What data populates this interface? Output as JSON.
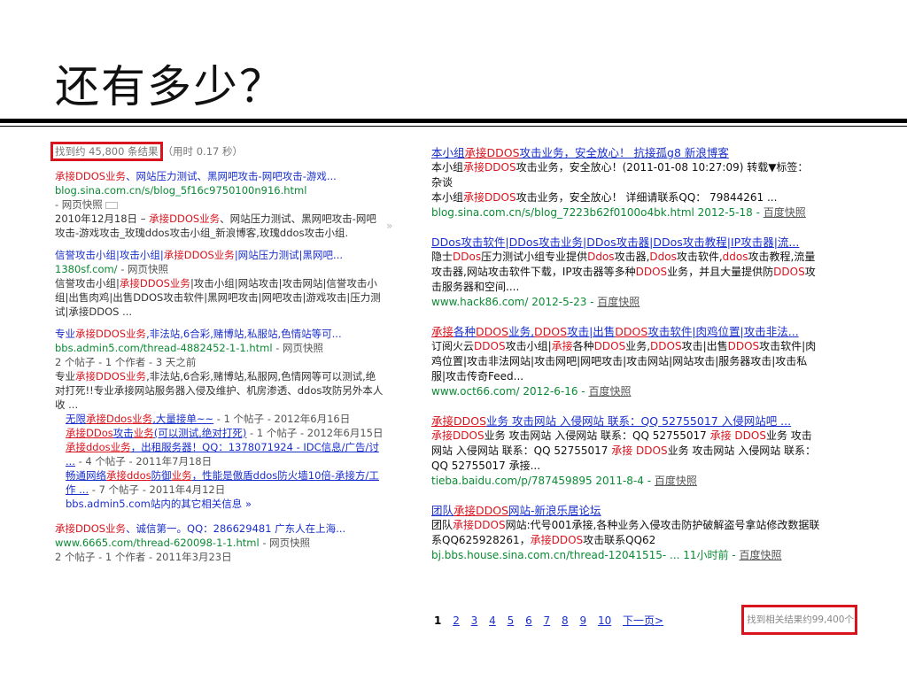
{
  "slide": {
    "title": "还有多少？"
  },
  "google": {
    "stats_count": "找到约 45,800 条结果",
    "stats_time": "（用时 0.17 秒）",
    "arrow": "»",
    "r1": {
      "title_a": "承接DDOS业务",
      "title_b": "、网站压力测试、黑网吧攻击-网吧攻击-游戏...",
      "url": "blog.sina.com.cn/s/blog_5f16c9750100n916.html",
      "cache": "- 网页快照",
      "date": "2010年12月18日 – ",
      "kw": "承接DDOS业务",
      "snippet": "、网站压力测试、黑网吧攻击-网吧攻击-游戏攻击_玫瑰ddos攻击小组_新浪博客,玫瑰ddos攻击小组."
    },
    "r2": {
      "title_a": "信誉攻击小组|攻击小组|",
      "title_kw": "承接DDOS业务",
      "title_b": "|网站压力测试|黑网吧...",
      "url": "1380sf.com/",
      "cache": " - 网页快照",
      "snip_a": "信誉攻击小组|",
      "snip_kw": "承接DDOS业务",
      "snip_b": "|攻击小组|网站攻击|攻击网站|信誉攻击小组|出售肉鸡|出售DDOS攻击软件|黑网吧攻击|网吧攻击|游戏攻击|压力测试|承接DDOS ..."
    },
    "r3": {
      "title_a": "专业",
      "title_kw": "承接DDOS业务",
      "title_b": ",非法站,6合彩,赌博站,私服站,色情站等可...",
      "url": "bbs.admin5.com/thread-4882452-1-1.html",
      "cache": " - 网页快照",
      "meta": "2 个帖子 - 1 个作者 - 3 天之前",
      "snip_a": "专业",
      "snip_kw": "承接DDOS业务",
      "snip_b": ",非法站,6合彩,赌博站,私服网,色情网等可以测试,绝对打死!!专业承接网站服务器入侵及维护、机房渗透、ddos攻防另外本人收 ...",
      "s1_a": "无限",
      "s1_kw": "承接Ddos业务",
      "s1_b": ",大量接单~~",
      "s1_meta": " - 1 个帖子 - 2012年6月16日",
      "s2_kw": "承接DDos",
      "s2_a": "攻击",
      "s2_kw2": "业务",
      "s2_b": "(可以测试,绝对打死)",
      "s2_meta": " - 1 个帖子 - 2012年6月15日",
      "s3_kw": "承接ddos业务",
      "s3_b": "，出租服务器！QQ：1378071924 - IDC信息/广告/讨 ...",
      "s3_meta": " - 4 个帖子 - 2011年7月18日",
      "s4_a": "畅通网络",
      "s4_kw": "承接ddos",
      "s4_b": "防御",
      "s4_kw2": "业务",
      "s4_c": "，性能是傲盾ddos防火墙10倍-承接方/工作 ...",
      "s4_meta": " - 7 个帖子 - 2011年4月12日",
      "more": "bbs.admin5.com站内的其它相关信息 »"
    },
    "r4": {
      "title_kw": "承接DDOS业务",
      "title_b": "、诚信第一。QQ：286629481 广东人在上海...",
      "url": "www.6665.com/thread-620098-1-1.html",
      "cache": " - 网页快照",
      "meta": "2 个帖子 - 1 个作者 - 2011年3月23日"
    }
  },
  "baidu": {
    "r1": {
      "title_a": "本小组",
      "title_kw": "承接DDOS",
      "title_b": "攻击业务，安全放心！ 抗接孤g8 新浪博客",
      "snip1_a": "本小组",
      "snip1_kw": "承接",
      "snip1_kw2": "DDOS",
      "snip1_b": "攻击业务，安全放心！(2011-01-08 10:27:09) 转载▼标签： 杂谈",
      "snip2_a": "本小组",
      "snip2_kw": "承接",
      "snip2_kw2": "DDOS",
      "snip2_b": "攻击业务，安全放心！ 详细请联系QQ： 79844261 ...",
      "url": "blog.sina.com.cn/s/blog_7223b62f0100o4bk.html 2012-5-18 - ",
      "cache": "百度快照"
    },
    "r2": {
      "title": "DDos攻击软件|DDos攻击业务|DDos攻击器|DDos攻击教程|IP攻击器|流...",
      "s_a": "隐士",
      "s_kw1": "DDos",
      "s_b": "压力测试小组专业提供",
      "s_kw2": "Ddos",
      "s_c": "攻击器,",
      "s_kw3": "Ddos",
      "s_d": "攻击软件,",
      "s_kw4": "ddos",
      "s_e": "攻击教程,流量攻击器,网站攻击软件下载，IP攻击器等多种",
      "s_kw5": "DDOS",
      "s_f": "业务，并且大量提供防",
      "s_kw6": "DDOS",
      "s_g": "攻击服务器和空间....",
      "url": "www.hack86.com/ 2012-5-23 - ",
      "cache": "百度快照"
    },
    "r3": {
      "title_kw": "承接",
      "title_a": "各种",
      "title_kw2": "DDOS",
      "title_b": "业务,",
      "title_kw3": "DDOS",
      "title_c": "攻击|出售",
      "title_kw4": "DDOS",
      "title_d": "攻击软件|肉鸡位置|攻击非法...",
      "s_a": "订阅火云",
      "s_kw1": "DDOS",
      "s_b": "攻击小组|",
      "s_kw2": "承接",
      "s_c": "各种",
      "s_kw3": "DDOS",
      "s_d": "业务,",
      "s_kw4": "DDOS",
      "s_e": "攻击|出售",
      "s_kw5": "DDOS",
      "s_f": "攻击软件|肉鸡位置|攻击非法网站|攻击网吧|网吧攻击|攻击网站|网站攻击|服务器攻击|攻击私服|攻击传奇Feed...",
      "url": "www.oct66.com/ 2012-6-16 - ",
      "cache": "百度快照"
    },
    "r4": {
      "title_kw": "承接DDOS",
      "title_b": "业务 攻击网站 入侵网站 联系：QQ 52755017 入侵网站吧 ...",
      "s_kw1": "承接",
      "s_kw2": "DDOS",
      "s_a": "业务 攻击网站 入侵网站 联系：QQ 52755017 ",
      "s_kw3": "承接 DDOS",
      "s_b": "业务 攻击网站 入侵网站 联系：QQ 52755017 ",
      "s_kw4": "承接 DDOS",
      "s_c": "业务 攻击网站 入侵网站 联系：QQ 52755017 承接...",
      "url": "tieba.baidu.com/p/787459895 2011-8-4 - ",
      "cache": "百度快照"
    },
    "r5": {
      "title_a": "团队",
      "title_kw": "承接DDOS",
      "title_b": "网站-新浪乐居论坛",
      "s_a": "团队",
      "s_kw1": "承接",
      "s_kw2": "DDOS",
      "s_b": "网站:代号001承接,各种业务入侵攻击防护破解盗号拿站修改数据联系QQ625928261，",
      "s_kw3": "承接DDOS",
      "s_c": "攻击联系QQ62",
      "url": "bj.bbs.house.sina.com.cn/thread-12041515- ... 11小时前 - ",
      "cache": "百度快照"
    },
    "pager": [
      "1",
      "2",
      "3",
      "4",
      "5",
      "6",
      "7",
      "8",
      "9",
      "10",
      "下一页>"
    ],
    "stats": "找到相关结果约99,400个"
  }
}
